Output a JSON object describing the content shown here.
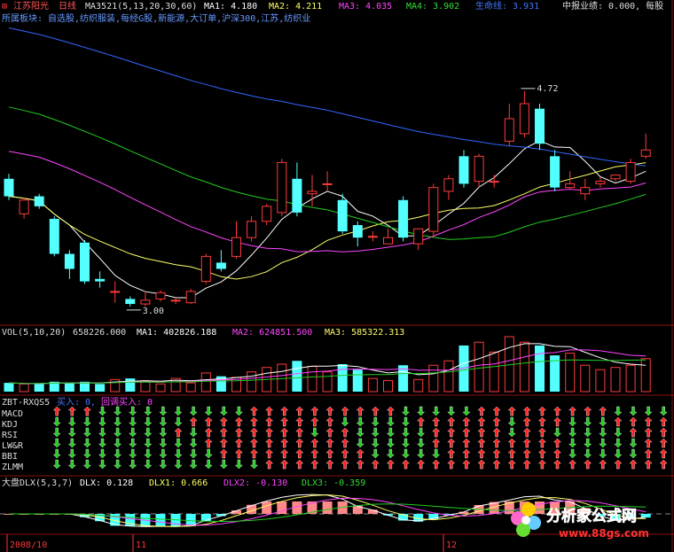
{
  "header": {
    "stock_name": "江苏阳光",
    "period": "日线",
    "ma_label": "MA3521(5,13,20,30,60)",
    "ma1": "MA1: 4.180",
    "ma2": "MA2: 4.211",
    "ma3": "MA3: 4.035",
    "ma4": "MA4: 3.902",
    "life_line": "生命线: 3.931",
    "report": "中报业绩: 0.000, 每股",
    "sector": "所属板块: 自选股,纺织服装,每经G股,新能源,大订单,沪深300,江苏,纺织业"
  },
  "vol_panel": {
    "label": "VOL(5,10,20)",
    "vol": "658226.000",
    "ma1": "MA1: 402826.188",
    "ma2": "MA2: 624851.500",
    "ma3": "MA3: 585322.313"
  },
  "zbt_panel": {
    "label": "ZBT-RXQS5",
    "buy": "买入: 0,",
    "rebuy": "回调买入: 0",
    "rows": [
      "MACD",
      "KDJ",
      "RSI",
      "LW&R",
      "BBI",
      "ZLMM"
    ]
  },
  "dlx_panel": {
    "label": "大盘DLX(5,3,7)",
    "dlx": "DLX: 0.128",
    "dlx1": "DLX1: 0.666",
    "dlx2": "DLX2: -0.130",
    "dlx3": "DLX3: -0.359"
  },
  "date_axis": {
    "labels": [
      "2008/10",
      "11",
      "12"
    ]
  },
  "watermark": {
    "brand": "分析家公式网",
    "url": "www.88gs.com"
  },
  "colors": {
    "up": "#ff3b3b",
    "down": "#54ffff",
    "ma1": "#ffffff",
    "ma2": "#ffff66",
    "ma3": "#ff44ff",
    "ma4": "#22cc22",
    "ma5": "#3366ff"
  },
  "chart_data": {
    "type": "candlestick",
    "price_range": [
      2.9,
      5.25
    ],
    "annotations": [
      {
        "label": "4.72",
        "candle": 34
      },
      {
        "label": "3.00",
        "candle": 8
      }
    ],
    "candles": [
      {
        "o": 4.02,
        "c": 3.88,
        "h": 4.06,
        "l": 3.85
      },
      {
        "o": 3.74,
        "c": 3.85,
        "h": 3.87,
        "l": 3.7
      },
      {
        "o": 3.88,
        "c": 3.8,
        "h": 3.9,
        "l": 3.78
      },
      {
        "o": 3.7,
        "c": 3.42,
        "h": 3.72,
        "l": 3.4
      },
      {
        "o": 3.42,
        "c": 3.3,
        "h": 3.45,
        "l": 3.22
      },
      {
        "o": 3.51,
        "c": 3.2,
        "h": 3.53,
        "l": 3.18
      },
      {
        "o": 3.22,
        "c": 3.2,
        "h": 3.28,
        "l": 3.15
      },
      {
        "o": 3.12,
        "c": 3.12,
        "h": 3.2,
        "l": 3.03
      },
      {
        "o": 3.06,
        "c": 3.02,
        "h": 3.08,
        "l": 3.0
      },
      {
        "o": 3.02,
        "c": 3.05,
        "h": 3.12,
        "l": 3.0
      },
      {
        "o": 3.06,
        "c": 3.11,
        "h": 3.13,
        "l": 3.04
      },
      {
        "o": 3.05,
        "c": 3.05,
        "h": 3.07,
        "l": 3.02
      },
      {
        "o": 3.03,
        "c": 3.12,
        "h": 3.14,
        "l": 3.02
      },
      {
        "o": 3.2,
        "c": 3.4,
        "h": 3.42,
        "l": 3.18
      },
      {
        "o": 3.35,
        "c": 3.3,
        "h": 3.45,
        "l": 3.28
      },
      {
        "o": 3.4,
        "c": 3.55,
        "h": 3.68,
        "l": 3.38
      },
      {
        "o": 3.55,
        "c": 3.68,
        "h": 3.72,
        "l": 3.52
      },
      {
        "o": 3.68,
        "c": 3.8,
        "h": 3.82,
        "l": 3.65
      },
      {
        "o": 3.75,
        "c": 4.15,
        "h": 4.18,
        "l": 3.72
      },
      {
        "o": 4.02,
        "c": 3.75,
        "h": 4.15,
        "l": 3.72
      },
      {
        "o": 3.9,
        "c": 3.92,
        "h": 4.05,
        "l": 3.8
      },
      {
        "o": 3.98,
        "c": 3.98,
        "h": 4.08,
        "l": 3.92
      },
      {
        "o": 3.85,
        "c": 3.6,
        "h": 3.9,
        "l": 3.58
      },
      {
        "o": 3.65,
        "c": 3.55,
        "h": 3.68,
        "l": 3.48
      },
      {
        "o": 3.56,
        "c": 3.56,
        "h": 3.6,
        "l": 3.52
      },
      {
        "o": 3.5,
        "c": 3.55,
        "h": 3.62,
        "l": 3.5
      },
      {
        "o": 3.85,
        "c": 3.55,
        "h": 3.88,
        "l": 3.52
      },
      {
        "o": 3.5,
        "c": 3.62,
        "h": 3.62,
        "l": 3.45
      },
      {
        "o": 3.6,
        "c": 3.95,
        "h": 3.98,
        "l": 3.55
      },
      {
        "o": 3.92,
        "c": 4.02,
        "h": 4.05,
        "l": 3.85
      },
      {
        "o": 4.2,
        "c": 3.98,
        "h": 4.25,
        "l": 3.95
      },
      {
        "o": 4.0,
        "c": 4.2,
        "h": 4.22,
        "l": 3.95
      },
      {
        "o": 4.0,
        "c": 4.0,
        "h": 4.05,
        "l": 3.95
      },
      {
        "o": 4.32,
        "c": 4.5,
        "h": 4.62,
        "l": 4.28
      },
      {
        "o": 4.38,
        "c": 4.62,
        "h": 4.72,
        "l": 4.35
      },
      {
        "o": 4.58,
        "c": 4.3,
        "h": 4.62,
        "l": 4.25
      },
      {
        "o": 4.2,
        "c": 3.95,
        "h": 4.25,
        "l": 3.92
      },
      {
        "o": 3.95,
        "c": 3.98,
        "h": 4.08,
        "l": 3.93
      },
      {
        "o": 3.9,
        "c": 3.95,
        "h": 4.02,
        "l": 3.85
      },
      {
        "o": 3.98,
        "c": 4.0,
        "h": 4.03,
        "l": 3.95
      },
      {
        "o": 4.02,
        "c": 4.05,
        "h": 4.05,
        "l": 4.0
      },
      {
        "o": 4.0,
        "c": 4.15,
        "h": 4.18,
        "l": 3.98
      },
      {
        "o": 4.2,
        "c": 4.25,
        "h": 4.38,
        "l": 4.18
      }
    ],
    "volumes": [
      0.08,
      0.07,
      0.07,
      0.09,
      0.08,
      0.09,
      0.07,
      0.11,
      0.12,
      0.1,
      0.07,
      0.12,
      0.08,
      0.17,
      0.14,
      0.13,
      0.18,
      0.22,
      0.25,
      0.28,
      0.23,
      0.18,
      0.25,
      0.2,
      0.12,
      0.1,
      0.24,
      0.11,
      0.24,
      0.28,
      0.42,
      0.45,
      0.36,
      0.5,
      0.45,
      0.42,
      0.33,
      0.35,
      0.24,
      0.2,
      0.22,
      0.24,
      0.3
    ]
  }
}
